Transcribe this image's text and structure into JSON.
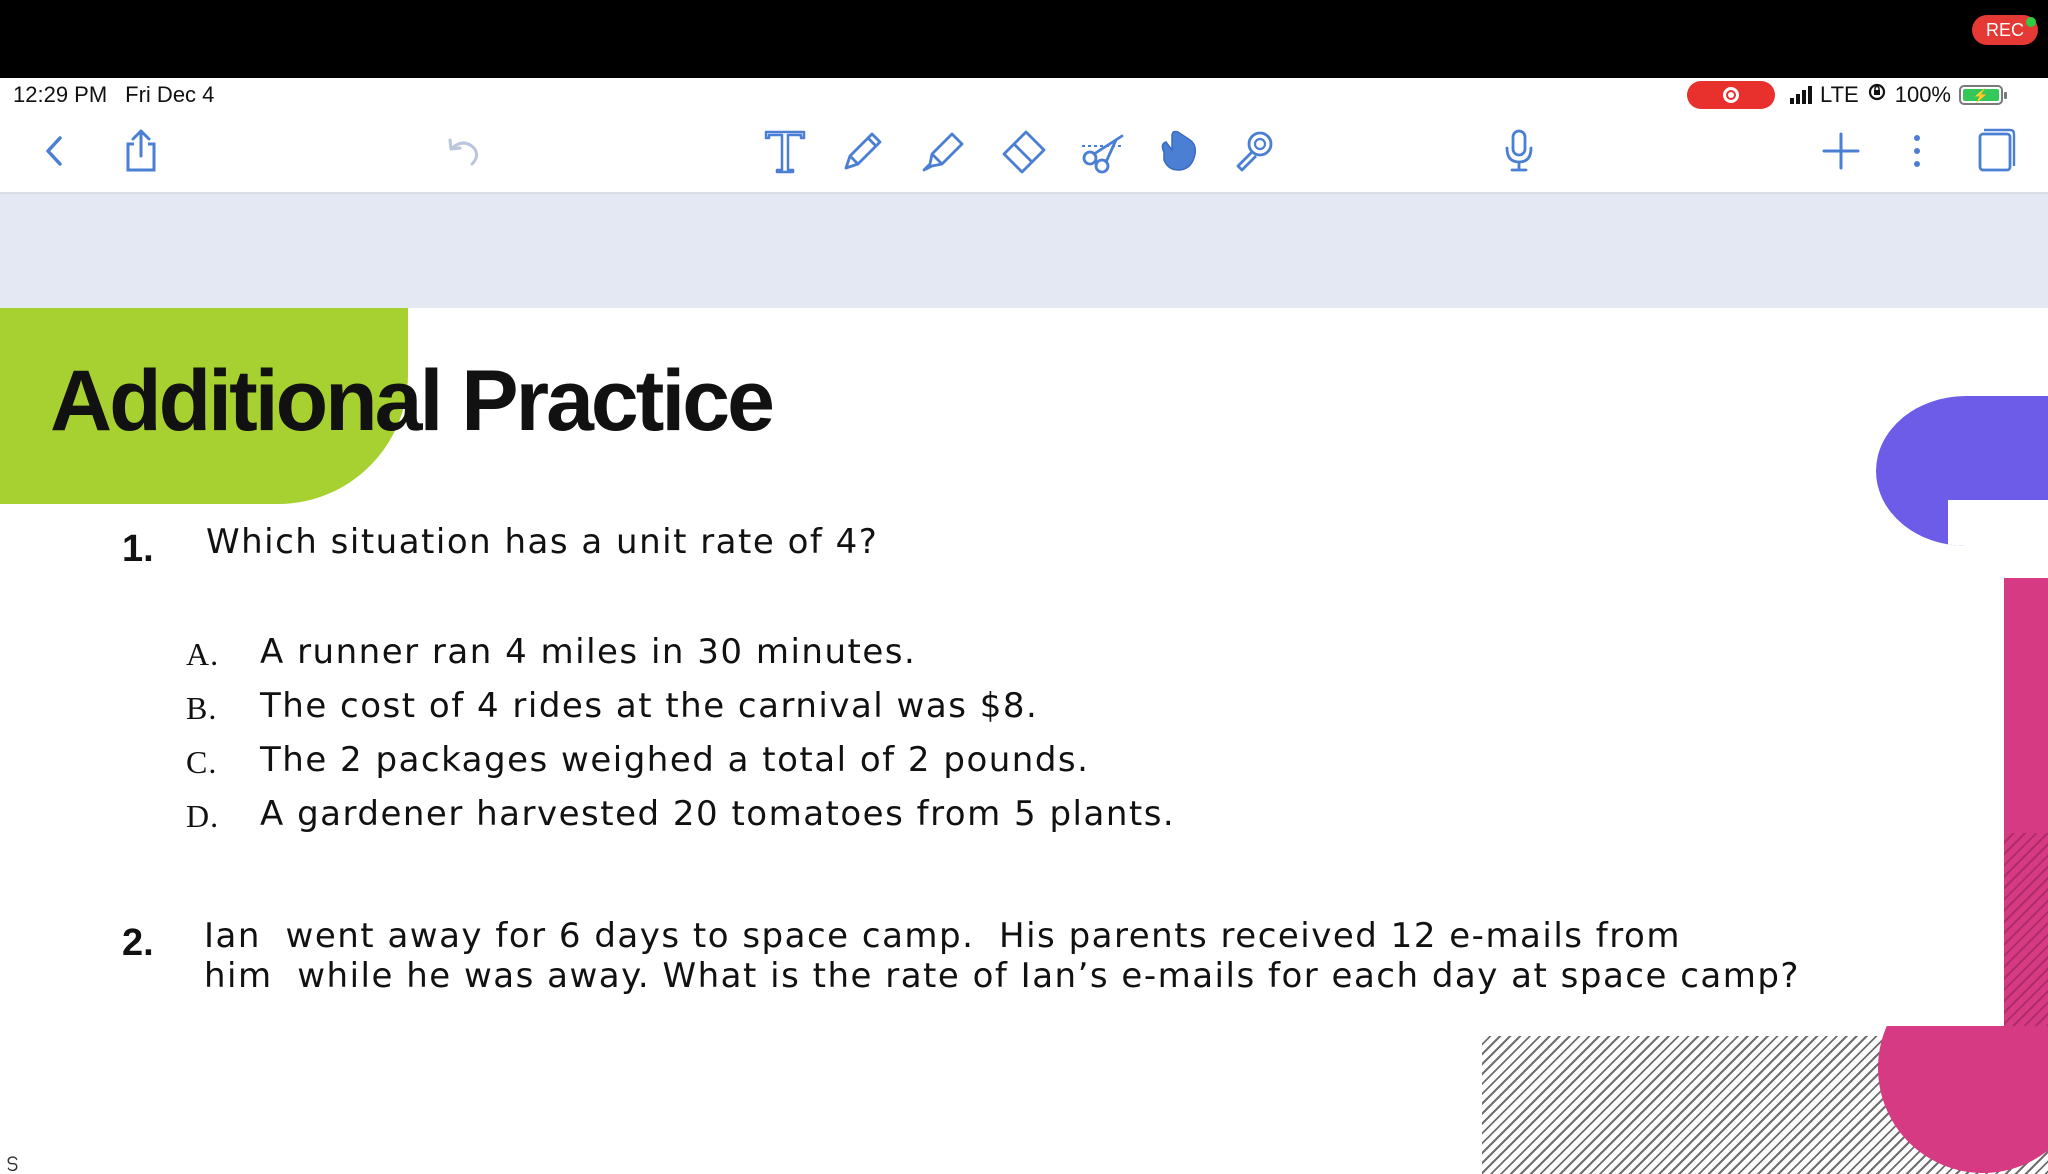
{
  "recording_badge": "REC",
  "status_bar": {
    "time": "12:29 PM",
    "date": "Fri Dec 4",
    "network": "LTE",
    "battery": "100%"
  },
  "toolbar": {
    "left": [
      "back-icon",
      "share-icon",
      "undo-icon"
    ],
    "tools": [
      "text-tool-icon",
      "pen-tool-icon",
      "highlighter-tool-icon",
      "eraser-tool-icon",
      "scissors-tool-icon",
      "hand-tool-icon",
      "laser-pointer-icon"
    ],
    "right": [
      "microphone-icon",
      "add-page-icon",
      "more-icon",
      "pages-icon"
    ],
    "accent": "#4a7fd4"
  },
  "page": {
    "title": "Additional Practice",
    "accent_green": "#a7d130",
    "accent_purple": "#6c5ce7",
    "accent_pink": "#d63a82",
    "corner_mark": "ഗ",
    "question1": {
      "number": "1.",
      "text": "Which situation has a unit rate of 4?",
      "options": [
        {
          "letter": "A.",
          "text": "A runner ran 4 miles in 30 minutes."
        },
        {
          "letter": "B.",
          "text": "The cost of 4 rides at the carnival was $8."
        },
        {
          "letter": "C.",
          "text": "The 2 packages weighed a total of 2 pounds."
        },
        {
          "letter": "D.",
          "text": "A gardener harvested 20 tomatoes from 5 plants."
        }
      ]
    },
    "question2": {
      "number": "2.",
      "line1": "Ian  went away for 6 days to space camp.  His parents received 12 e-mails from",
      "line2": "him  while he was away. What is the rate of Ian’s e-mails for each day at space camp?"
    }
  }
}
